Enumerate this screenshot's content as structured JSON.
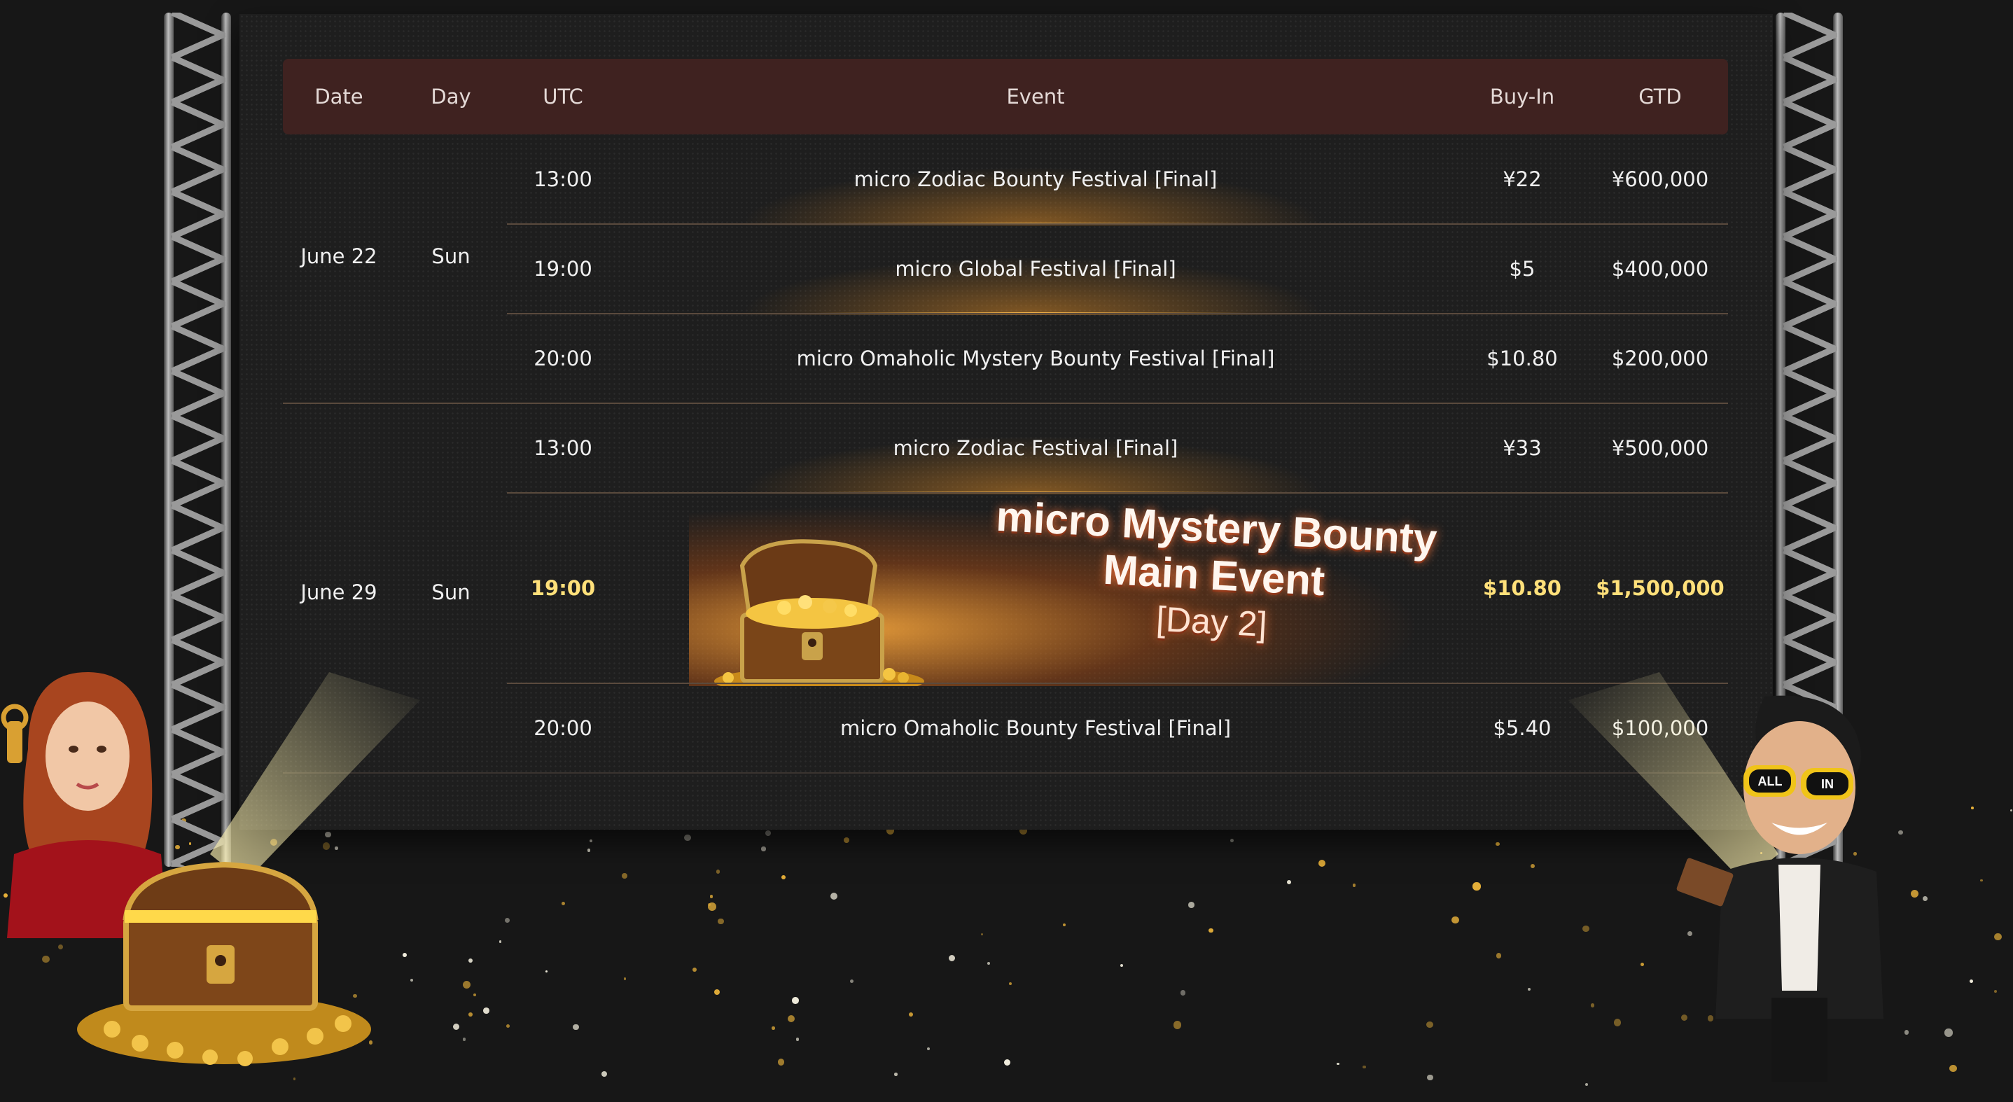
{
  "table": {
    "headers": {
      "date": "Date",
      "day": "Day",
      "utc": "UTC",
      "event": "Event",
      "buyin": "Buy-In",
      "gtd": "GTD"
    },
    "groups": [
      {
        "date": "June 22",
        "day": "Sun"
      },
      {
        "date": "June 29",
        "day": "Sun"
      }
    ],
    "rows": [
      {
        "utc": "13:00",
        "event": "micro Zodiac Bounty Festival [Final]",
        "buyin": "¥22",
        "gtd": "¥600,000"
      },
      {
        "utc": "19:00",
        "event": "micro Global Festival [Final]",
        "buyin": "$5",
        "gtd": "$400,000"
      },
      {
        "utc": "20:00",
        "event": "micro Omaholic Mystery Bounty Festival [Final]",
        "buyin": "$10.80",
        "gtd": "$200,000"
      },
      {
        "utc": "13:00",
        "event": "micro Zodiac Festival [Final]",
        "buyin": "¥33",
        "gtd": "¥500,000"
      },
      {
        "utc": "19:00",
        "event": "",
        "buyin": "$10.80",
        "gtd": "$1,500,000"
      },
      {
        "utc": "20:00",
        "event": "micro Omaholic Bounty Festival [Final]",
        "buyin": "$5.40",
        "gtd": "$100,000"
      }
    ]
  },
  "banner": {
    "line1": "micro Mystery Bounty",
    "line2": "Main Event",
    "line3": "[Day 2]"
  },
  "colors": {
    "header_bg": "#3f2220",
    "highlight": "#ffe07a",
    "background": "#171717"
  },
  "icons": [
    "treasure-chest-icon",
    "gold-coins-icon",
    "truss-pillar",
    "woman-mascot",
    "man-mascot-all-in-glasses"
  ]
}
